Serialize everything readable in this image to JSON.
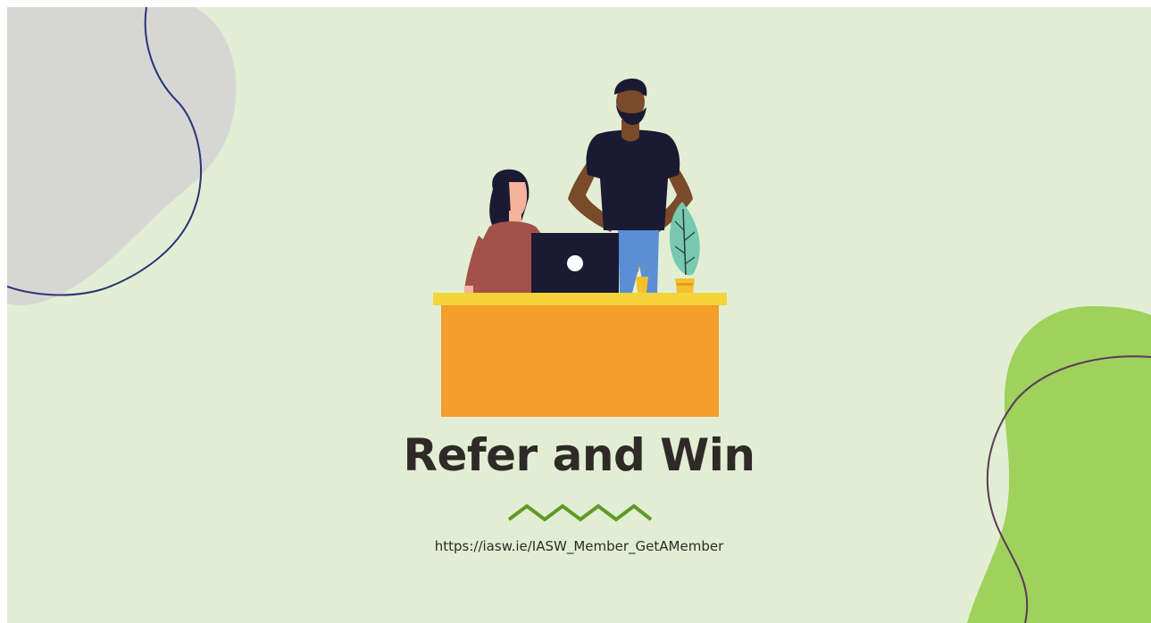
{
  "slide": {
    "title": "Refer and Win",
    "url": "https://iasw.ie/IASW_Member_GetAMember"
  },
  "colors": {
    "background": "#e1eed3",
    "gray_blob": "#d6d6d5",
    "green_blob": "#9fd15c",
    "line_navy": "#2a3578",
    "line_plum": "#5b3a59",
    "desk_top": "#f5d33b",
    "desk_front": "#f59e2c",
    "laptop": "#1b1a33",
    "title_text": "#2f2a27",
    "url_text": "#2f2a27",
    "zigzag": "#5f9a25"
  },
  "icons": [
    "man-standing-figure",
    "woman-sitting-figure",
    "laptop-icon",
    "plant-pot-icon",
    "coffee-cup-icon",
    "zigzag-divider-icon"
  ]
}
